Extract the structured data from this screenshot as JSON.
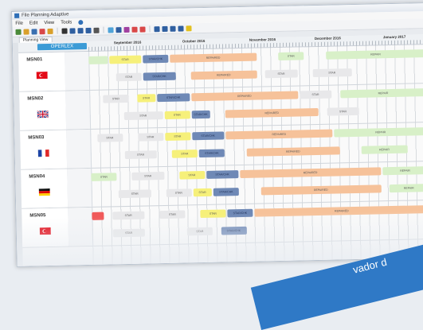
{
  "app": {
    "title": "File Planning Adaptive",
    "menu": [
      "File",
      "Edit",
      "View",
      "Tools"
    ],
    "tab": "Planning View",
    "logo_text": "OPERLEX"
  },
  "toolbar_colors": [
    "#4a8a3a",
    "#d9a02b",
    "#3a6fb0",
    "#d94848",
    "#d9a02b",
    "#333333",
    "#2f5fa0",
    "#2f5fa0",
    "#2f5fa0",
    "#555555",
    "#4fa3d8",
    "#2f5fa0",
    "#a040a0",
    "#d94848",
    "#d94848",
    "#2f5fa0",
    "#2f5fa0",
    "#2f5fa0",
    "#2f5fa0",
    "#e2c020"
  ],
  "timeline": {
    "months": [
      "September 2016",
      "October 2016",
      "November 2016",
      "December 2016",
      "January 2017"
    ]
  },
  "rows": [
    {
      "msn": "MSN01",
      "flag": "turkey",
      "bars": [
        {
          "start": 0,
          "end": 0.06,
          "track": 0,
          "kind": "green",
          "label": ""
        },
        {
          "start": 0.06,
          "end": 0.16,
          "track": 0,
          "kind": "yellow",
          "label": "STAR"
        },
        {
          "start": 0.16,
          "end": 0.24,
          "track": 0,
          "kind": "blue",
          "label": "STAR/CHK"
        },
        {
          "start": 0.24,
          "end": 0.5,
          "track": 0,
          "kind": "orange",
          "label": "REPAIRED"
        },
        {
          "start": 0.56,
          "end": 0.64,
          "track": 0,
          "kind": "green",
          "label": "STAR"
        },
        {
          "start": 0.7,
          "end": 1,
          "track": 0,
          "kind": "green",
          "label": "REPAIR"
        },
        {
          "start": 0.08,
          "end": 0.16,
          "track": 1,
          "kind": "grey",
          "label": "STAR"
        },
        {
          "start": 0.16,
          "end": 0.26,
          "track": 1,
          "kind": "blue",
          "label": "STAR/CHK"
        },
        {
          "start": 0.3,
          "end": 0.5,
          "track": 1,
          "kind": "orange",
          "label": "REPAIRED"
        },
        {
          "start": 0.52,
          "end": 0.62,
          "track": 1,
          "kind": "grey",
          "label": "STAR"
        },
        {
          "start": 0.66,
          "end": 0.78,
          "track": 1,
          "kind": "grey",
          "label": "STAR"
        }
      ]
    },
    {
      "msn": "MSN02",
      "flag": "uk",
      "bars": [
        {
          "start": 0.04,
          "end": 0.12,
          "track": 0,
          "kind": "grey",
          "label": "STAR"
        },
        {
          "start": 0.14,
          "end": 0.2,
          "track": 0,
          "kind": "yellow",
          "label": "STAR"
        },
        {
          "start": 0.2,
          "end": 0.3,
          "track": 0,
          "kind": "blue",
          "label": "STAR/CHK"
        },
        {
          "start": 0.3,
          "end": 0.62,
          "track": 0,
          "kind": "orange",
          "label": "REPAIRED"
        },
        {
          "start": 0.62,
          "end": 0.72,
          "track": 0,
          "kind": "grey",
          "label": "STAR"
        },
        {
          "start": 0.74,
          "end": 1,
          "track": 0,
          "kind": "green",
          "label": "REPAIR"
        },
        {
          "start": 0.1,
          "end": 0.22,
          "track": 1,
          "kind": "grey",
          "label": "STAR"
        },
        {
          "start": 0.22,
          "end": 0.3,
          "track": 1,
          "kind": "yellow",
          "label": "STAR"
        },
        {
          "start": 0.3,
          "end": 0.36,
          "track": 1,
          "kind": "blue",
          "label": "STAR/CHK"
        },
        {
          "start": 0.4,
          "end": 0.68,
          "track": 1,
          "kind": "orange",
          "label": "REPAIRED"
        },
        {
          "start": 0.7,
          "end": 0.8,
          "track": 1,
          "kind": "grey",
          "label": "STAR"
        }
      ]
    },
    {
      "msn": "MSN03",
      "flag": "france",
      "bars": [
        {
          "start": 0.02,
          "end": 0.1,
          "track": 0,
          "kind": "grey",
          "label": "STAR"
        },
        {
          "start": 0.14,
          "end": 0.22,
          "track": 0,
          "kind": "grey",
          "label": "STAR"
        },
        {
          "start": 0.22,
          "end": 0.3,
          "track": 0,
          "kind": "yellow",
          "label": "STAR"
        },
        {
          "start": 0.3,
          "end": 0.4,
          "track": 0,
          "kind": "blue",
          "label": "STAR/CHK"
        },
        {
          "start": 0.4,
          "end": 0.72,
          "track": 0,
          "kind": "orange",
          "label": "REPAIRED"
        },
        {
          "start": 0.72,
          "end": 1,
          "track": 0,
          "kind": "green",
          "label": "REPAIR"
        },
        {
          "start": 0.1,
          "end": 0.2,
          "track": 1,
          "kind": "grey",
          "label": "STAR"
        },
        {
          "start": 0.24,
          "end": 0.32,
          "track": 1,
          "kind": "yellow",
          "label": "STAR"
        },
        {
          "start": 0.32,
          "end": 0.4,
          "track": 1,
          "kind": "blue",
          "label": "STAR/CHK"
        },
        {
          "start": 0.46,
          "end": 0.74,
          "track": 1,
          "kind": "orange",
          "label": "REPAIRED"
        },
        {
          "start": 0.8,
          "end": 0.94,
          "track": 1,
          "kind": "green",
          "label": "REPAIR"
        }
      ]
    },
    {
      "msn": "MSN04",
      "flag": "germany",
      "bars": [
        {
          "start": 0.0,
          "end": 0.08,
          "track": 0,
          "kind": "green",
          "label": "STAR"
        },
        {
          "start": 0.12,
          "end": 0.22,
          "track": 0,
          "kind": "grey",
          "label": "STAR"
        },
        {
          "start": 0.26,
          "end": 0.34,
          "track": 0,
          "kind": "yellow",
          "label": "STAR"
        },
        {
          "start": 0.34,
          "end": 0.44,
          "track": 0,
          "kind": "blue",
          "label": "STAR/CHK"
        },
        {
          "start": 0.44,
          "end": 0.86,
          "track": 0,
          "kind": "orange",
          "label": "REPAIRED"
        },
        {
          "start": 0.86,
          "end": 1,
          "track": 0,
          "kind": "green",
          "label": "REPAIR"
        },
        {
          "start": 0.08,
          "end": 0.18,
          "track": 1,
          "kind": "grey",
          "label": "STAR"
        },
        {
          "start": 0.22,
          "end": 0.3,
          "track": 1,
          "kind": "grey",
          "label": "STAR"
        },
        {
          "start": 0.3,
          "end": 0.36,
          "track": 1,
          "kind": "yellow",
          "label": "STAR"
        },
        {
          "start": 0.36,
          "end": 0.44,
          "track": 1,
          "kind": "blue",
          "label": "STAR/CHK"
        },
        {
          "start": 0.5,
          "end": 0.86,
          "track": 1,
          "kind": "orange",
          "label": "REPAIRED"
        },
        {
          "start": 0.88,
          "end": 1,
          "track": 1,
          "kind": "green",
          "label": "REPAIR"
        }
      ]
    },
    {
      "msn": "MSN05",
      "flag": "turkey",
      "bars": [
        {
          "start": 0.0,
          "end": 0.04,
          "track": 0,
          "kind": "red",
          "label": ""
        },
        {
          "start": 0.06,
          "end": 0.16,
          "track": 0,
          "kind": "grey",
          "label": "STAR"
        },
        {
          "start": 0.2,
          "end": 0.28,
          "track": 0,
          "kind": "grey",
          "label": "STAR"
        },
        {
          "start": 0.32,
          "end": 0.4,
          "track": 0,
          "kind": "yellow",
          "label": "STAR"
        },
        {
          "start": 0.4,
          "end": 0.48,
          "track": 0,
          "kind": "blue",
          "label": "STAR/CHK"
        },
        {
          "start": 0.48,
          "end": 1,
          "track": 0,
          "kind": "orange",
          "label": "REPAIRED"
        },
        {
          "start": 0.06,
          "end": 0.16,
          "track": 1,
          "kind": "grey",
          "label": "STAR"
        },
        {
          "start": 0.28,
          "end": 0.36,
          "track": 1,
          "kind": "grey",
          "label": "STAR"
        },
        {
          "start": 0.38,
          "end": 0.46,
          "track": 1,
          "kind": "blue",
          "label": "STAR/CHK"
        }
      ]
    }
  ],
  "bar_colors": {
    "grey": "#e8e8ea",
    "yellow": "#f6f07a",
    "blue": "#6f89b6",
    "orange": "#f6c29a",
    "green": "#d8f0c8",
    "red": "#f05a5a"
  },
  "banner_text": "vador d"
}
